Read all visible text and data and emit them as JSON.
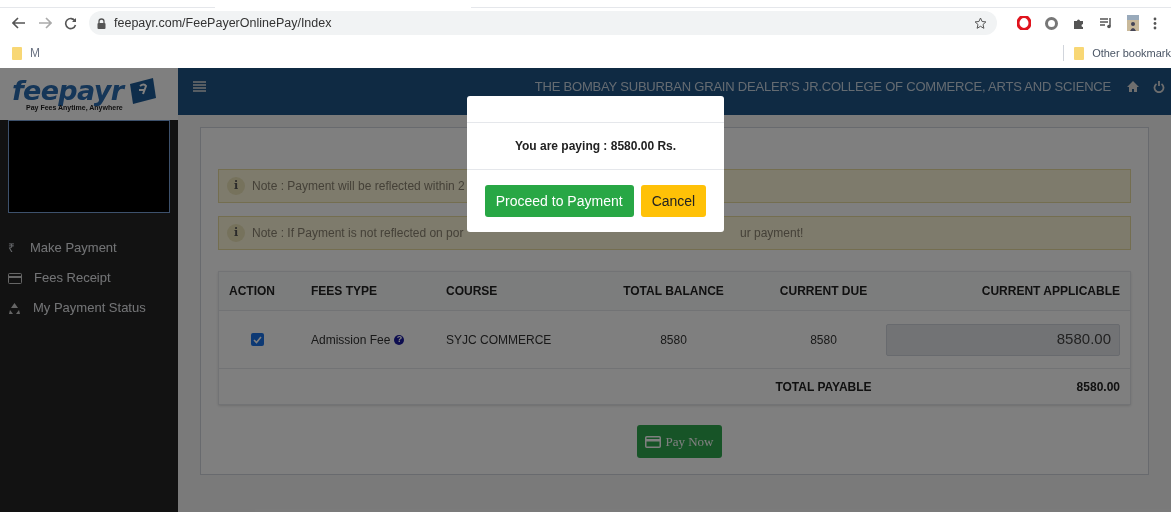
{
  "browser": {
    "url": "feepayr.com/FeePayerOnlinePay/Index",
    "bookmarks": [
      {
        "label": "M"
      }
    ],
    "other_bookmarks": "Other bookmark"
  },
  "sidebar": {
    "logo": "feepayr",
    "tagline": "Pay Fees Anytime, Anywhere",
    "items": [
      {
        "label": "Make Payment",
        "glyph": "₹"
      },
      {
        "label": "Fees Receipt"
      },
      {
        "label": "My Payment Status"
      }
    ]
  },
  "header": {
    "title": "THE BOMBAY SUBURBAN GRAIN DEALER'S JR.COLLEGE OF COMMERCE, ARTS AND SCIENCE"
  },
  "notes": [
    {
      "icon_text": "i",
      "text_left": "Note : Payment will be reflected within 2"
    },
    {
      "icon_text": "i",
      "text_left": "Note : If Payment is not reflected on por",
      "text_right": "ur payment!"
    }
  ],
  "table": {
    "columns": [
      "ACTION",
      "FEES TYPE",
      "COURSE",
      "TOTAL BALANCE",
      "CURRENT DUE",
      "CURRENT APPLICABLE"
    ],
    "rows": [
      {
        "checked": true,
        "fees_type": "Admission Fee",
        "help_glyph": "?",
        "course": "SYJC COMMERCE",
        "total_balance": "8580",
        "current_due": "8580",
        "current_applicable": "8580.00"
      }
    ],
    "total_label": "TOTAL PAYABLE",
    "total_value": "8580.00"
  },
  "pay_button": "Pay Now",
  "modal": {
    "message": "You are paying : 8580.00 Rs.",
    "buttons": [
      {
        "label": "Proceed to Payment",
        "kind": "primary"
      },
      {
        "label": "Cancel",
        "kind": "warning"
      }
    ]
  }
}
